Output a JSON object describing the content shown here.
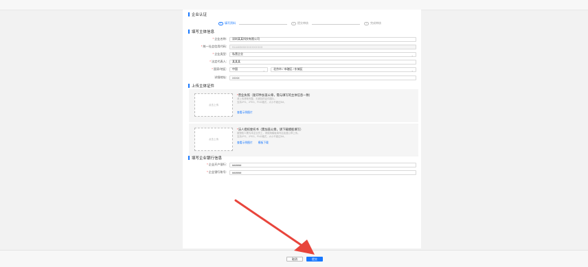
{
  "page": {
    "title": "企业认证"
  },
  "steps": [
    {
      "index": "1",
      "label": "填写资料",
      "state": "active"
    },
    {
      "index": "2",
      "label": "提交审核",
      "state": "inactive"
    },
    {
      "index": "3",
      "label": "完成审核",
      "state": "inactive"
    }
  ],
  "basic": {
    "section_title": "填写主体信息",
    "company_name_label": "企业名称:",
    "company_name_value": "深圳某某科技有限公司",
    "credit_code_label": "统一社会信用代码:",
    "credit_code_value": "91440300XXXXXXXXXX",
    "company_type_label": "企业类型:",
    "company_type_value": "私营企业",
    "legal_person_label": "法定代表人:",
    "legal_person_value": "某某某",
    "region_label": "国家/地区:",
    "region_country": "中国",
    "region_detail": "北京市 / 市辖区 / 东城区",
    "address_label": "详细地址:",
    "address_value": "XXXX"
  },
  "upload": {
    "section_title": "上传主体证件",
    "panels": [
      {
        "box_label": "点击上传",
        "heading": "营业执照（复印件加盖公章，需与填写的主体信息一致）",
        "desc1": "请上传清晰完整、无遮挡的证件图片。",
        "desc2": "支持JPG、JPEG、PNG格式，大小不超过5M。",
        "link1": "查看示例图片",
        "link2": ""
      },
      {
        "box_label": "点击上传",
        "heading": "法人授权委托书（需加盖公章，请下载模板填写）",
        "desc1": "被授权人需为本企业员工，请使用模板填写后加盖公章上传。",
        "desc2": "支持JPG、JPEG、PNG格式，大小不超过5M。",
        "link1": "查看示例图片",
        "link2": "模板下载"
      }
    ]
  },
  "bank": {
    "section_title": "填写企业银行信息",
    "bank_name_label": "企业开户银行:",
    "bank_name_value": "######",
    "bank_account_label": "企业银行账号:",
    "bank_account_value": "######"
  },
  "footer": {
    "cancel_label": "取消",
    "submit_label": "提交"
  },
  "colors": {
    "accent": "#1677ff",
    "arrow": "#e8453c",
    "required": "#ee3333"
  }
}
